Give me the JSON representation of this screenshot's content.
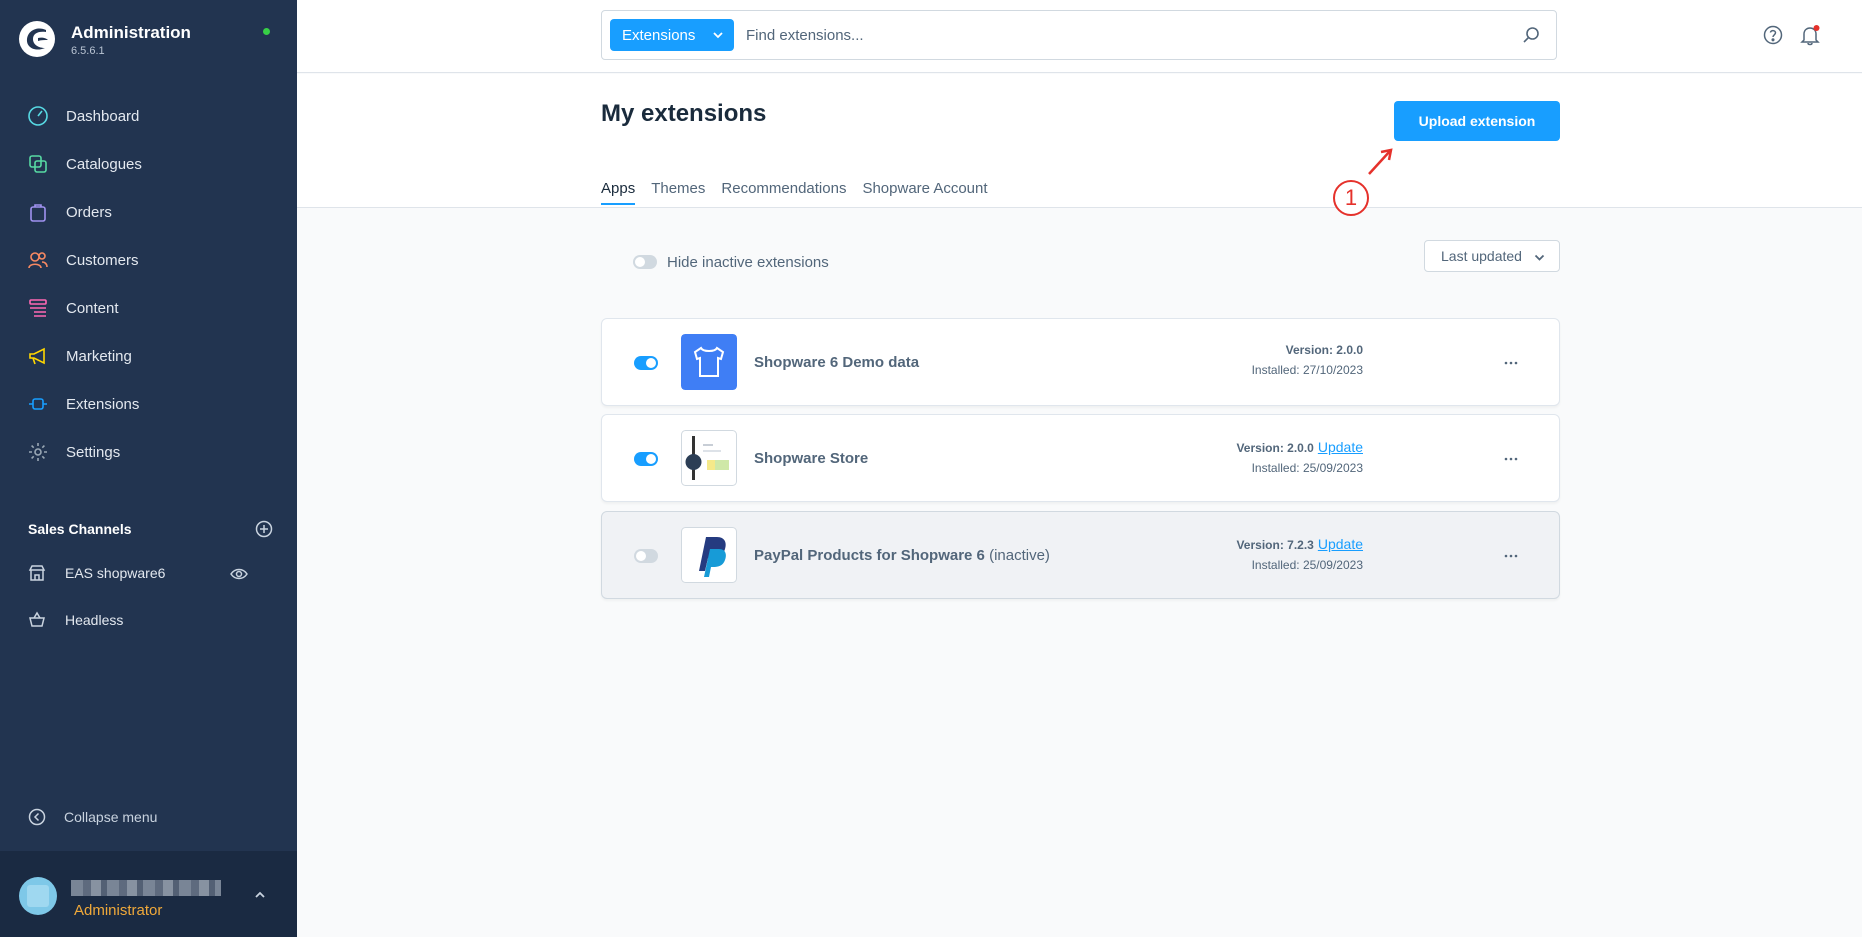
{
  "app": {
    "title": "Administration",
    "version": "6.5.6.1"
  },
  "nav": [
    {
      "label": "Dashboard",
      "icon": "dashboard-icon",
      "color": "#57d9e3"
    },
    {
      "label": "Catalogues",
      "icon": "catalogue-icon",
      "color": "#57d9a3"
    },
    {
      "label": "Orders",
      "icon": "shopping-bag-icon",
      "color": "#a092f0"
    },
    {
      "label": "Customers",
      "icon": "customers-icon",
      "color": "#f88962"
    },
    {
      "label": "Content",
      "icon": "content-icon",
      "color": "#ff68b4"
    },
    {
      "label": "Marketing",
      "icon": "megaphone-icon",
      "color": "#ffd700"
    },
    {
      "label": "Extensions",
      "icon": "plug-icon",
      "color": "#189eff"
    },
    {
      "label": "Settings",
      "icon": "gear-icon",
      "color": "#9aa8b5"
    }
  ],
  "sales_channels": {
    "title": "Sales Channels",
    "items": [
      {
        "label": "EAS shopware6",
        "icon": "storefront-icon"
      },
      {
        "label": "Headless",
        "icon": "basket-icon"
      }
    ]
  },
  "collapse_label": "Collapse menu",
  "user": {
    "role": "Administrator"
  },
  "search": {
    "type_label": "Extensions",
    "placeholder": "Find extensions..."
  },
  "page": {
    "title": "My extensions",
    "upload_label": "Upload extension",
    "tabs": [
      "Apps",
      "Themes",
      "Recommendations",
      "Shopware Account"
    ],
    "active_tab": "Apps"
  },
  "annotation": {
    "number": "1"
  },
  "filter": {
    "hide_inactive_label": "Hide inactive extensions",
    "sort_label": "Last updated"
  },
  "extensions": [
    {
      "name": "Shopware 6 Demo data",
      "version": "Version: 2.0.0",
      "update": "",
      "installed": "Installed: 27/10/2023",
      "active": true,
      "inactive_label": ""
    },
    {
      "name": "Shopware Store",
      "version": "Version: 2.0.0",
      "update": "Update",
      "installed": "Installed: 25/09/2023",
      "active": true,
      "inactive_label": ""
    },
    {
      "name": "PayPal Products for Shopware 6",
      "version": "Version: 7.2.3",
      "update": "Update",
      "installed": "Installed: 25/09/2023",
      "active": false,
      "inactive_label": "(inactive)"
    }
  ],
  "colors": {
    "accent": "#189eff",
    "sidebar": "#223450",
    "annotation": "#e5312b"
  }
}
